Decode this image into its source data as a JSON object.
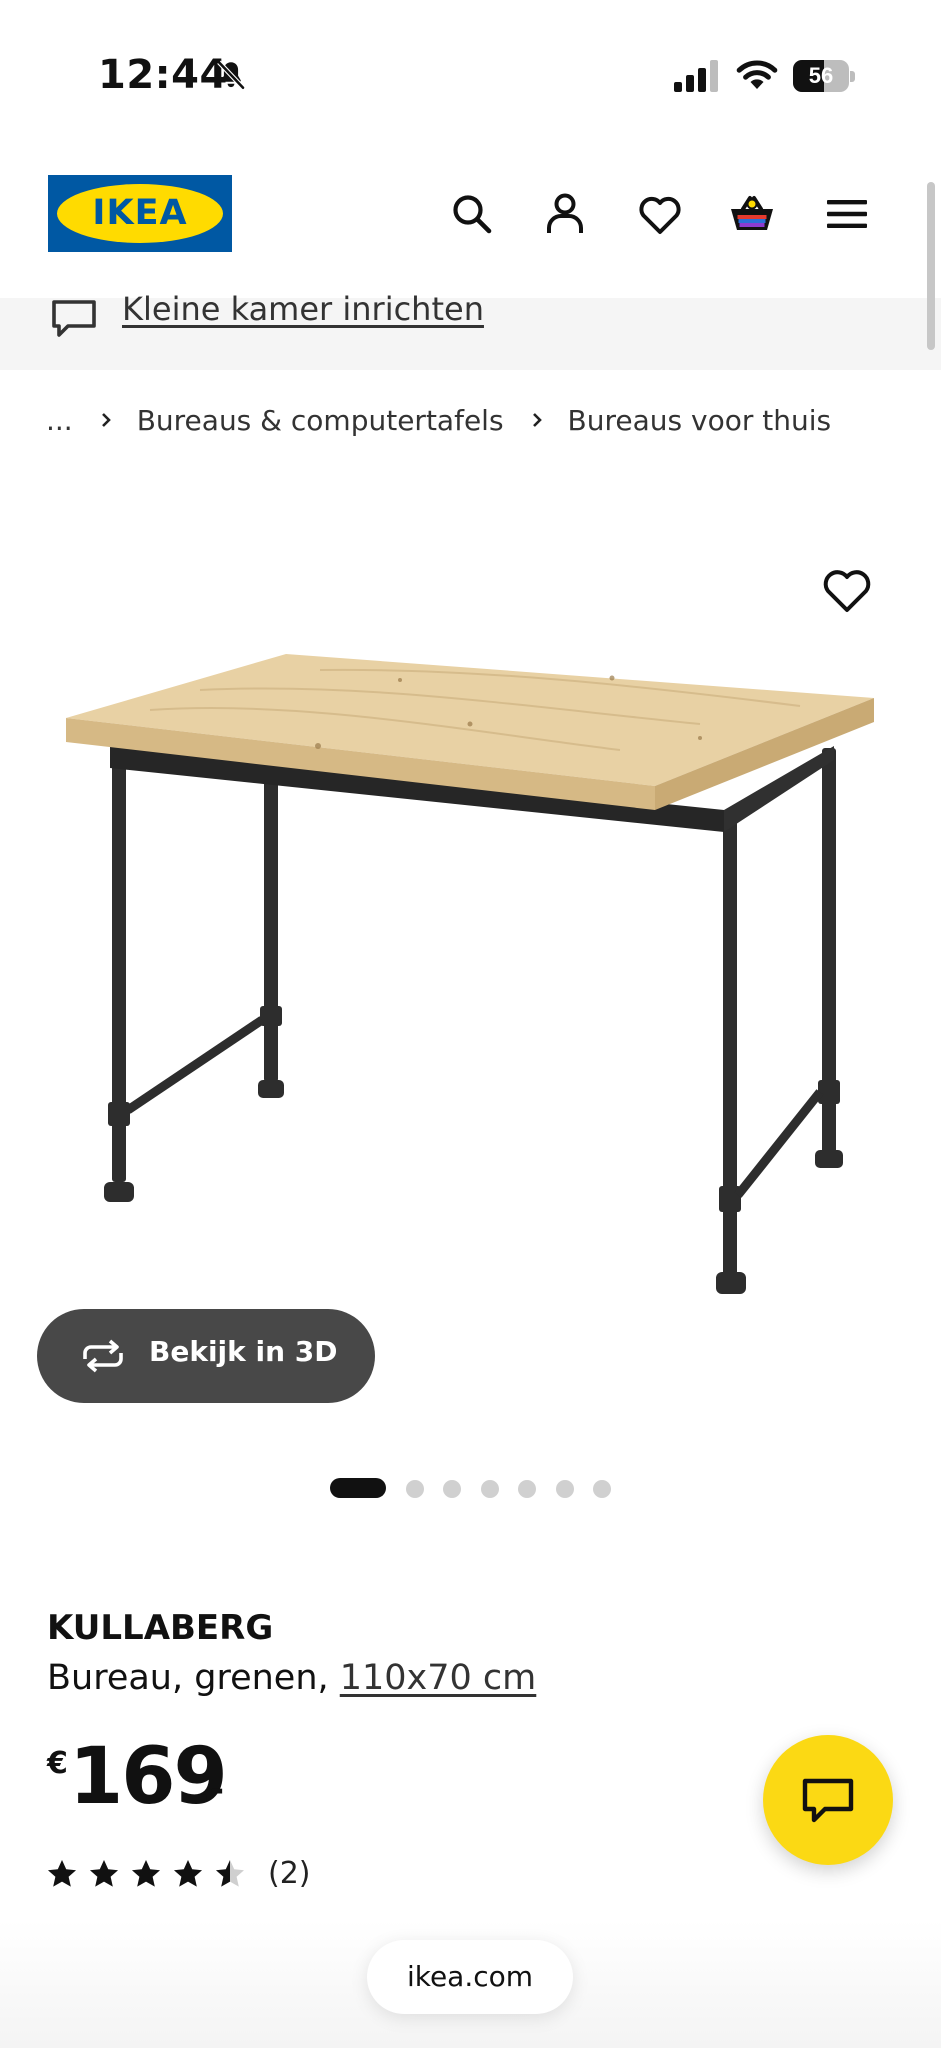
{
  "status_bar": {
    "time": "12:44",
    "battery_percent": "56",
    "battery_level": 0.56,
    "icons": [
      "bell-slash-icon",
      "cellular-signal-icon",
      "wifi-icon",
      "battery-icon"
    ]
  },
  "header": {
    "logo_text": "IKEA",
    "icons": [
      "search-icon",
      "account-icon",
      "heart-icon",
      "shopping-bag-icon",
      "menu-icon"
    ],
    "colors": {
      "logo_blue": "#0058a3",
      "logo_yellow": "#ffdb00"
    }
  },
  "promo": {
    "icon": "speech-bubble-icon",
    "link_text": "Kleine kamer inrichten"
  },
  "breadcrumb": {
    "items": [
      "...",
      "Bureaus & computertafels",
      "Bureaus voor thuis"
    ]
  },
  "gallery": {
    "image_alt": "KULLABERG bureau",
    "view_3d_label": "Bekijk in 3D",
    "total_images": 7,
    "active_index": 0
  },
  "product": {
    "name": "KULLABERG",
    "description": "Bureau, grenen, ",
    "size_link": "110x70 cm",
    "price_currency": "€",
    "price_integer": "169",
    "price_decimal": ".-",
    "rating_value": 4.5,
    "rating_max": 5,
    "review_count": "(2)"
  },
  "chat": {
    "icon": "chat-icon",
    "color": "#fbd914"
  },
  "browser": {
    "url": "ikea.com"
  }
}
